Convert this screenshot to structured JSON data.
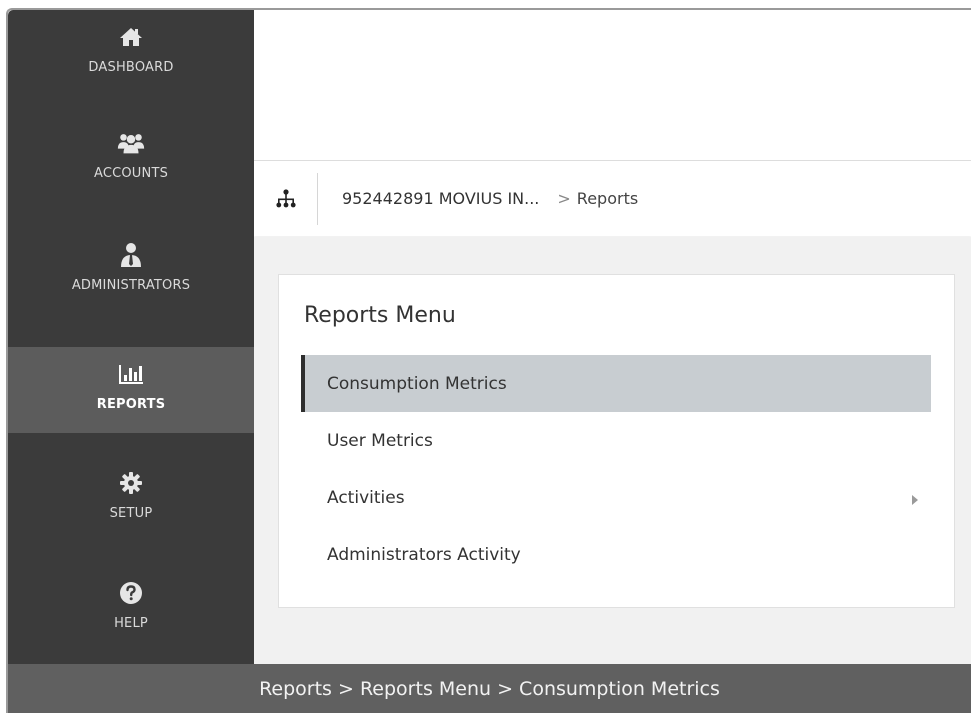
{
  "sidebar": {
    "items": [
      {
        "label": "DASHBOARD",
        "icon": "home-icon"
      },
      {
        "label": "ACCOUNTS",
        "icon": "users-icon"
      },
      {
        "label": "ADMINISTRATORS",
        "icon": "administrator-icon"
      },
      {
        "label": "REPORTS",
        "icon": "bar-chart-icon",
        "active": true
      },
      {
        "label": "SETUP",
        "icon": "gear-icon"
      },
      {
        "label": "HELP",
        "icon": "question-icon"
      }
    ]
  },
  "breadcrumb": {
    "tree_icon": "hierarchy-icon",
    "account": "952442891 MOVIUS IN...",
    "separator": ">",
    "current": "Reports"
  },
  "menu": {
    "title": "Reports Menu",
    "items": [
      {
        "label": "Consumption Metrics",
        "selected": true
      },
      {
        "label": "User Metrics"
      },
      {
        "label": "Activities",
        "has_submenu": true
      },
      {
        "label": "Administrators Activity"
      }
    ]
  },
  "footer": {
    "caption": "Reports > Reports Menu > Consumption Metrics"
  },
  "colors": {
    "sidebar_bg": "#3b3b3b",
    "sidebar_active_bg": "#5c5c5c",
    "selected_item_bg": "#c8cdd1",
    "content_bg": "#f1f1f1",
    "footer_bg": "#606060"
  }
}
